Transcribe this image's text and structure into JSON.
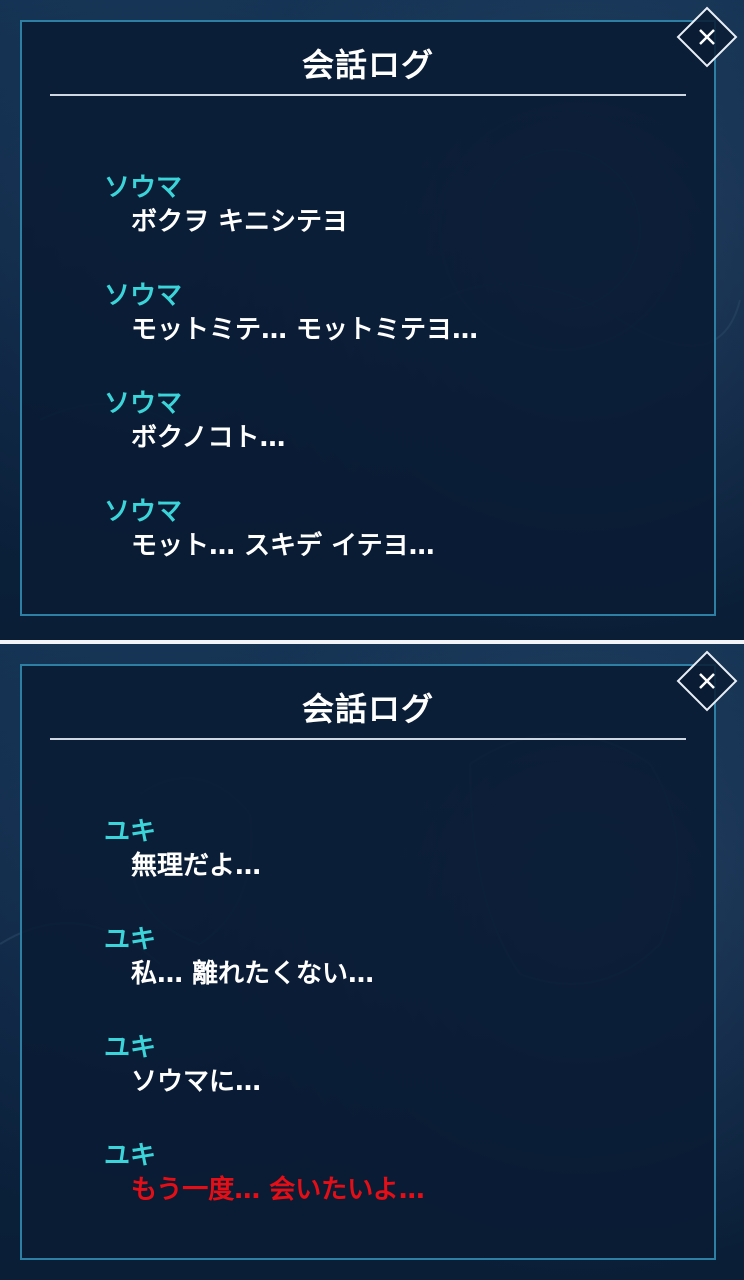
{
  "screens": [
    {
      "title": "会話ログ",
      "entries": [
        {
          "speaker": "ソウマ",
          "text": "ボクヲ キニシテヨ",
          "highlight": false
        },
        {
          "speaker": "ソウマ",
          "text": "モットミテ… モットミテヨ…",
          "highlight": false
        },
        {
          "speaker": "ソウマ",
          "text": "ボクノコト…",
          "highlight": false
        },
        {
          "speaker": "ソウマ",
          "text": "モット… スキデ イテヨ…",
          "highlight": false
        }
      ]
    },
    {
      "title": "会話ログ",
      "entries": [
        {
          "speaker": "ユキ",
          "text": "無理だよ…",
          "highlight": false
        },
        {
          "speaker": "ユキ",
          "text": "私… 離れたくない…",
          "highlight": false
        },
        {
          "speaker": "ユキ",
          "text": "ソウマに…",
          "highlight": false
        },
        {
          "speaker": "ユキ",
          "text": "もう一度… 会いたいよ…",
          "highlight": true
        }
      ]
    }
  ],
  "colors": {
    "speaker": "#3bd4d8",
    "text": "#ffffff",
    "highlight": "#e60e16",
    "panel_border": "#2d7fa3"
  },
  "icons": {
    "close": "close-icon"
  }
}
